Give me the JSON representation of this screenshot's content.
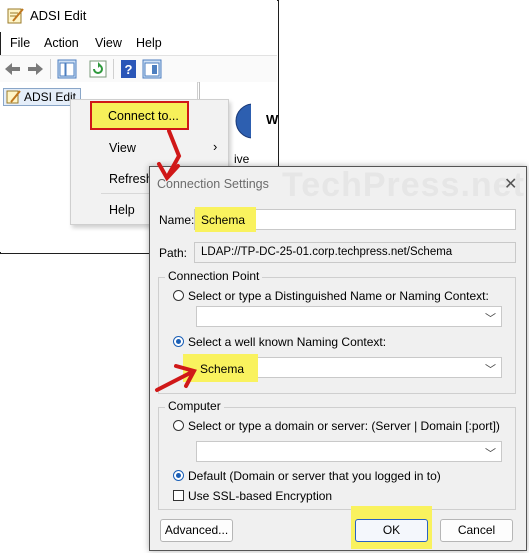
{
  "adsi": {
    "title": "ADSI Edit",
    "menus": [
      "File",
      "Action",
      "View",
      "Help"
    ],
    "tree_item": "ADSI Edit",
    "right_pane_partial_title": "W",
    "right_pane_partial_text": "ive Direc"
  },
  "context_menu": {
    "items": [
      "Connect to...",
      "View",
      "Refresh",
      "Help"
    ]
  },
  "dialog": {
    "title": "Connection Settings",
    "watermark": "TechPress.net",
    "name_label": "Name:",
    "name_value": "Schema",
    "path_label": "Path:",
    "path_value": "LDAP://TP-DC-25-01.corp.techpress.net/Schema",
    "connection_point": {
      "title": "Connection Point",
      "option_dn": "Select or type a Distinguished Name or Naming Context:",
      "dn_value": "",
      "option_known": "Select a well known Naming Context:",
      "known_value": "Schema",
      "selected": "known"
    },
    "computer": {
      "title": "Computer",
      "option_server": "Select or type a domain or server: (Server | Domain [:port])",
      "server_value": "",
      "option_default": "Default (Domain or server that you logged in to)",
      "selected": "default",
      "ssl_label": "Use SSL-based Encryption",
      "ssl_checked": false
    },
    "buttons": {
      "advanced": "Advanced...",
      "ok": "OK",
      "cancel": "Cancel"
    }
  },
  "colors": {
    "highlight": "#f9f25e",
    "arrow": "#d01818",
    "radio_accent": "#1b5fb6"
  }
}
